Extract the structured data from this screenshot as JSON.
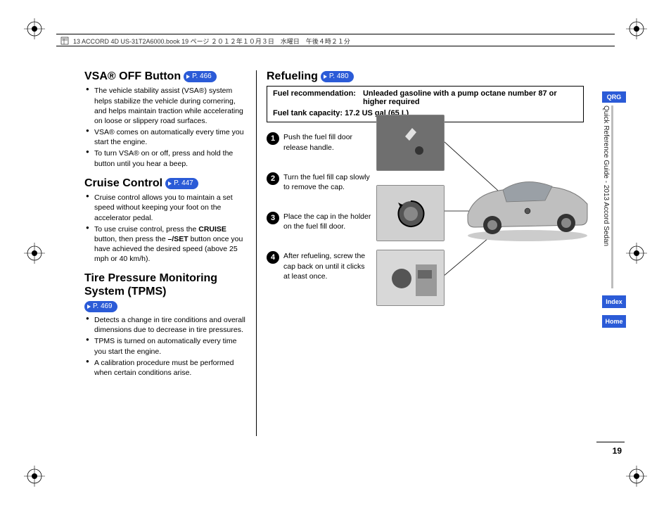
{
  "header": "13 ACCORD 4D US-31T2A6000.book  19 ページ  ２０１２年１０月３日　水曜日　午後４時２１分",
  "vsa": {
    "title": "VSA® OFF Button",
    "page": "P. 466",
    "bullets": [
      "The vehicle stability assist (VSA®) system helps stabilize the vehicle during cornering, and helps maintain traction while accelerating on loose or slippery road surfaces.",
      "VSA® comes on automatically every time you start the engine.",
      "To turn VSA® on or off, press and hold the button until you hear a beep."
    ]
  },
  "cruise": {
    "title": "Cruise Control",
    "page": "P. 447",
    "bullet1": "Cruise control allows you to maintain a set speed without keeping your foot on the accelerator pedal.",
    "bullet2_pre": "To use cruise control, press the ",
    "bullet2_b1": "CRUISE",
    "bullet2_mid": " button, then press the ",
    "bullet2_b2": "–/SET",
    "bullet2_post": " button once you have achieved the desired speed (above 25 mph or 40 km/h)."
  },
  "tpms": {
    "title": "Tire Pressure Monitoring System (TPMS)",
    "page": "P. 469",
    "bullets": [
      "Detects a change in tire conditions and overall dimensions due to decrease in tire pressures.",
      "TPMS is turned on automatically every time you start the engine.",
      "A calibration procedure must be performed when certain conditions arise."
    ]
  },
  "refuel": {
    "title": "Refueling",
    "page": "P. 480",
    "rec_label": "Fuel recommendation:",
    "rec_value": "Unleaded gasoline with a pump octane number 87 or higher required",
    "cap_label": "Fuel tank capacity:",
    "cap_value": "17.2 US gal (65 L)",
    "steps": [
      "Push the fuel fill door release handle.",
      "Turn the fuel fill cap slowly to remove the cap.",
      "Place the cap in the holder on the fuel fill door.",
      "After refueling, screw the cap back on until it clicks at least once."
    ]
  },
  "sidebar": {
    "qrg": "QRG",
    "guide": "Quick Reference Guide - 2013 Accord Sedan",
    "index": "Index",
    "home": "Home"
  },
  "page_number": "19"
}
